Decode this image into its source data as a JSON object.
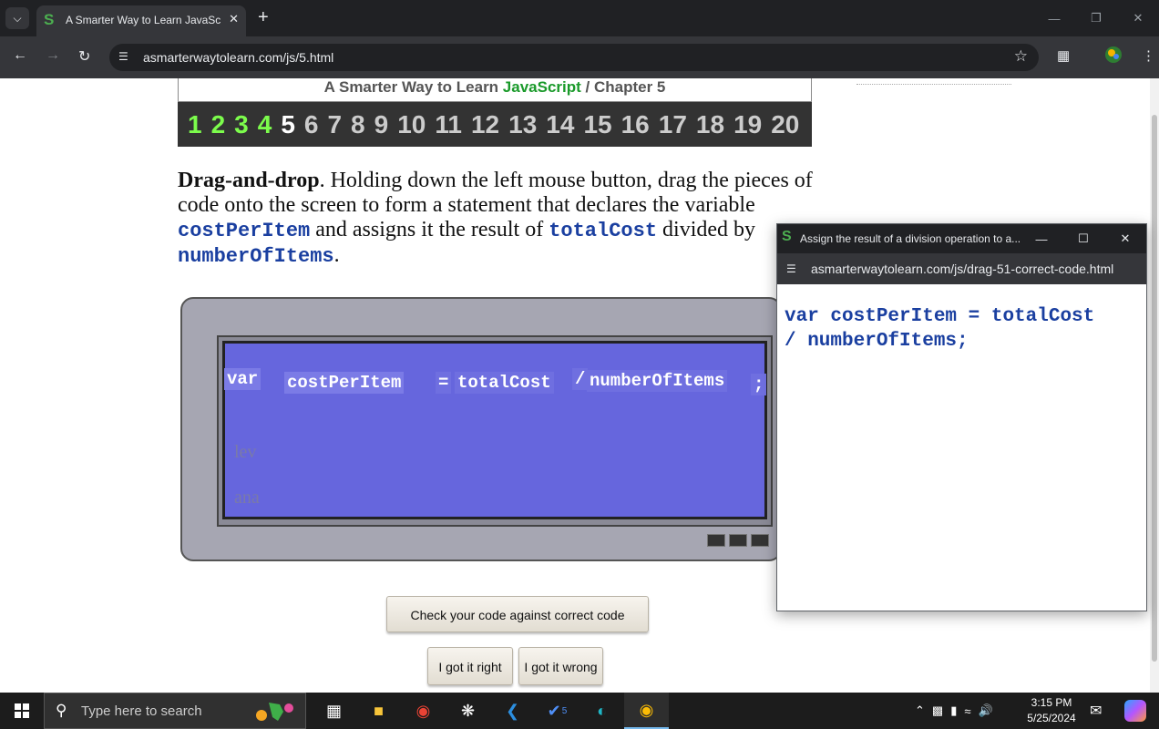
{
  "browser": {
    "tab_title": "A Smarter Way to Learn JavaSc",
    "tab_close": "✕",
    "new_tab": "+",
    "url": "asmarterwaytolearn.com/js/5.html",
    "favicon_letter": "S"
  },
  "page": {
    "header_prefix": "A Smarter Way to Learn ",
    "header_brand": "JavaScript",
    "header_suffix": " / Chapter 5",
    "chapters": [
      "1",
      "2",
      "3",
      "4",
      "5",
      "6",
      "7",
      "8",
      "9",
      "10",
      "11",
      "12",
      "13",
      "14",
      "15",
      "16",
      "17",
      "18",
      "19",
      "20"
    ],
    "chapters_completed": 4,
    "current_chapter": 5,
    "instruction": {
      "bold": "Drag-and-drop",
      "part1": ". Holding down the left mouse button, drag the pieces of code onto the screen to form a statement that declares the variable ",
      "code1": "costPerItem",
      "part2": " and assigns it the result of ",
      "code2": "totalCost",
      "part3": " divided by ",
      "code3": "numberOfItems",
      "part4": "."
    },
    "code_pieces": {
      "var": "var",
      "cost_per_item": "costPerItem",
      "equals": "=",
      "total_cost": "totalCost",
      "slash": "/",
      "number_of_items": "numberOfItems",
      "semicolon": ";"
    },
    "buttons": {
      "check": "Check your code against correct code",
      "got_right": "I got it right",
      "got_wrong": "I got it wrong"
    }
  },
  "popup": {
    "title": "Assign the result of a division operation to a...",
    "url": "asmarterwaytolearn.com/js/drag-51-correct-code.html",
    "code_line1": "var costPerItem = totalCost",
    "code_line2": "/ numberOfItems;"
  },
  "taskbar": {
    "search_placeholder": "Type here to search",
    "time": "3:15 PM",
    "date": "5/25/2024",
    "badge_count": "5"
  },
  "colors": {
    "brand_green": "#1a9a2a",
    "chapter_done": "#7cfc4c",
    "code_blue": "#1a3fa0",
    "screen_blue": "#6666dd"
  }
}
